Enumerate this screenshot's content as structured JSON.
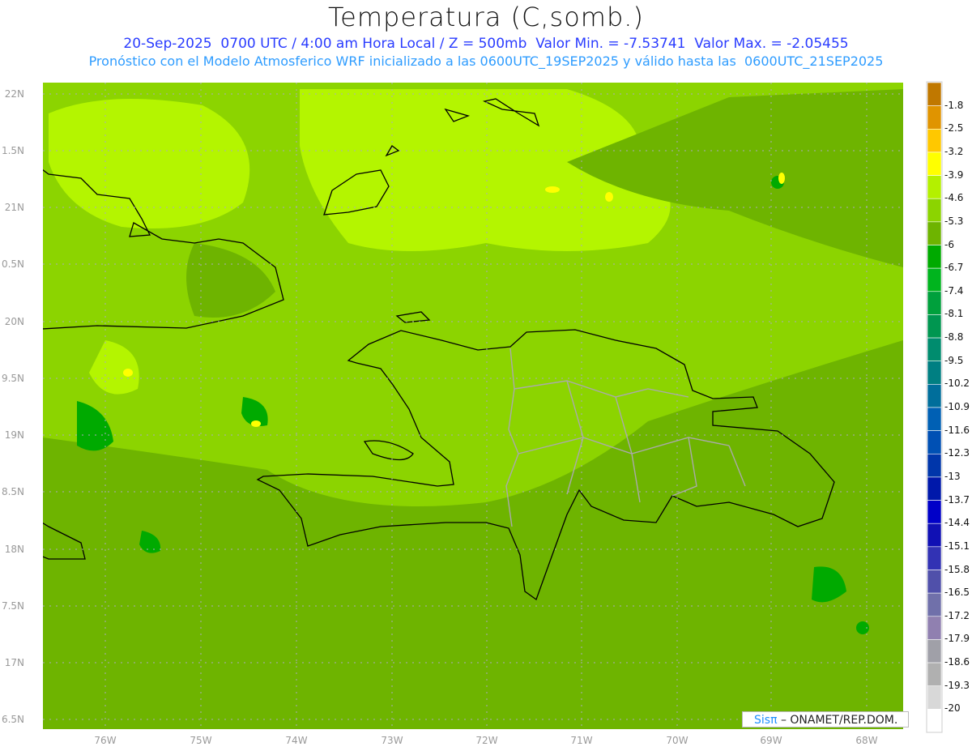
{
  "title": "Temperatura (C,somb.)",
  "subtitle1": "20-Sep-2025  0700 UTC / 4:00 am Hora Local / Z = 500mb  Valor Min. = -7.53741  Valor Max. = -2.05455",
  "subtitle2": "Pronóstico con el Modelo Atmosferico WRF inicializado a las 0600UTC_19SEP2025 y válido hasta las  0600UTC_21SEP2025",
  "y_labels": [
    "22N",
    "1.5N",
    "21N",
    "0.5N",
    "20N",
    "9.5N",
    "19N",
    "8.5N",
    "18N",
    "7.5N",
    "17N",
    "6.5N"
  ],
  "x_labels": [
    "76W",
    "75W",
    "74W",
    "73W",
    "72W",
    "71W",
    "70W",
    "69W",
    "68W"
  ],
  "colorbar": {
    "labels": [
      "-1.8",
      "-2.5",
      "-3.2",
      "-3.9",
      "-4.6",
      "-5.3",
      "-6",
      "-6.7",
      "-7.4",
      "-8.1",
      "-8.8",
      "-9.5",
      "-10.2",
      "-10.9",
      "-11.6",
      "-12.3",
      "-13",
      "-13.7",
      "-14.4",
      "-15.1",
      "-15.8",
      "-16.5",
      "-17.2",
      "-17.9",
      "-18.6",
      "-19.3",
      "-20"
    ],
    "colors": [
      "#c07800",
      "#e09400",
      "#ffc800",
      "#ffff00",
      "#b4f000",
      "#8cd400",
      "#6eb400",
      "#00aa00",
      "#00b41e",
      "#00a03c",
      "#009650",
      "#008c6e",
      "#007f82",
      "#006e9b",
      "#0060b4",
      "#0050b4",
      "#0036aa",
      "#0018aa",
      "#0000c8",
      "#1010b4",
      "#3232b4",
      "#5050aa",
      "#7070aa",
      "#9080b0",
      "#a0a0a8",
      "#b0b0b0",
      "#d8d8d8",
      "#ffffff"
    ]
  },
  "logo": {
    "brand": "Sisπ",
    "text": "– ONAMET/REP.DOM."
  }
}
